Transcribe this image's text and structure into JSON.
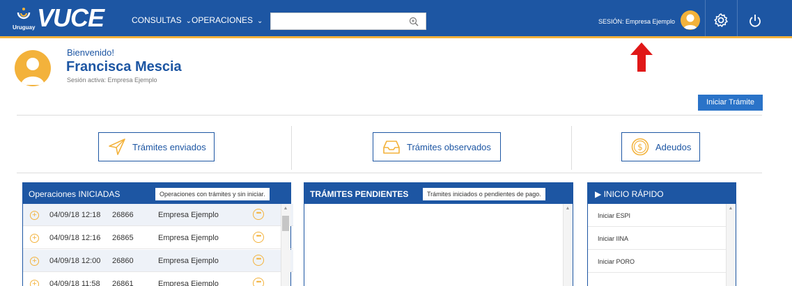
{
  "header": {
    "logo_country": "Uruguay",
    "logo_word": "VUCE",
    "nav": [
      {
        "label": "CONSULTAS"
      },
      {
        "label": "OPERACIONES"
      }
    ],
    "search_placeholder": "",
    "session_label": "SESIÓN: Empresa Ejemplo",
    "icons": {
      "search": "search-icon",
      "gear": "gear-icon",
      "power": "power-icon",
      "avatar": "user-avatar"
    }
  },
  "welcome": {
    "greeting": "Bienvenido!",
    "name": "Francisca Mescia",
    "session": "Sesión activa: Empresa Ejemplo"
  },
  "start_button": "Iniciar Trámite",
  "summary": [
    {
      "label": "Trámites enviados",
      "icon": "paper-plane-icon"
    },
    {
      "label": "Trámites observados",
      "icon": "inbox-tray-icon"
    },
    {
      "label": "Adeudos",
      "icon": "dollar-coin-icon"
    }
  ],
  "operations": {
    "title": "Operaciones INICIADAS",
    "tag": "Operaciones con trámites y sin iniciar.",
    "rows": [
      {
        "date": "04/09/18 12:18",
        "number": "26866",
        "company": "Empresa Ejemplo"
      },
      {
        "date": "04/09/18 12:16",
        "number": "26865",
        "company": "Empresa Ejemplo"
      },
      {
        "date": "04/09/18 12:00",
        "number": "26860",
        "company": "Empresa Ejemplo"
      },
      {
        "date": "04/09/18 11:58",
        "number": "26861",
        "company": "Empresa Ejemplo"
      }
    ]
  },
  "pending": {
    "title": "TRÁMITES PENDIENTES",
    "tag": "Trámites iniciados o pendientes de pago."
  },
  "quick": {
    "title": "INICIO RÁPIDO",
    "items": [
      {
        "label": "Iniciar ESPI"
      },
      {
        "label": "Iniciar IINA"
      },
      {
        "label": "Iniciar PORO"
      }
    ]
  },
  "colors": {
    "brand": "#1d56a3",
    "accent": "#f3b23b",
    "button": "#2a73c8",
    "arrow": "#e01818"
  }
}
